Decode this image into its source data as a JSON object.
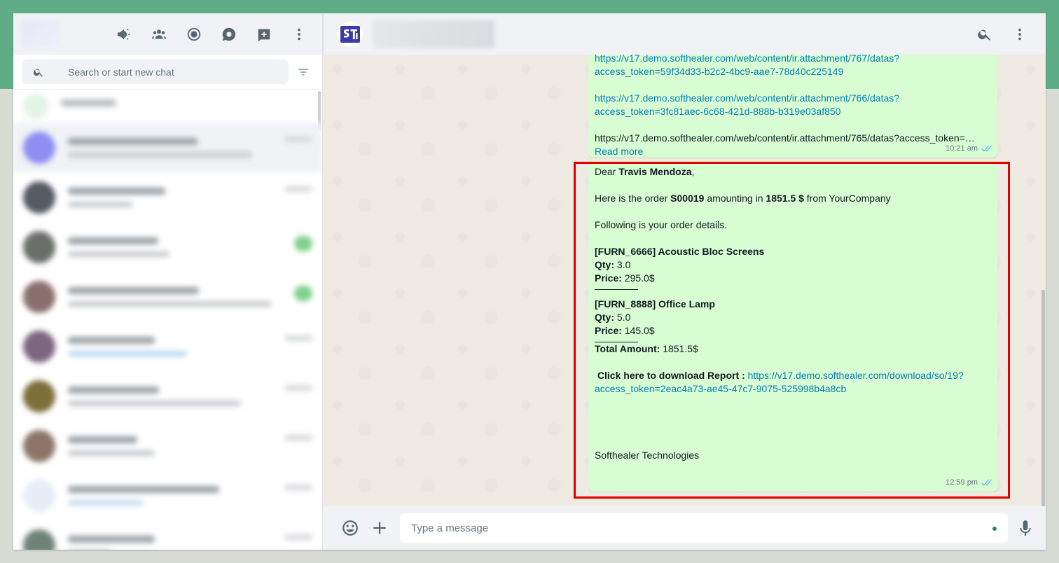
{
  "colors": {
    "top_band": "#5fad86",
    "bubble": "#d9fdd3",
    "link": "#027eb5",
    "highlight": "#e00000",
    "tick": "#53bdeb"
  },
  "sidebar": {
    "icons": [
      "communities-icon",
      "groups-icon",
      "status-icon",
      "channels-icon",
      "new-chat-icon",
      "menu-icon"
    ],
    "search_placeholder": "Search or start new chat"
  },
  "header": {
    "logo_icon": "softhealer-logo-icon",
    "icons": [
      "search-icon",
      "menu-icon"
    ]
  },
  "messages": [
    {
      "links": [
        {
          "url_line1": "https://v17.demo.softhealer.com/web/content/ir.attachment/767/datas?",
          "url_line2": "access_token=59f34d33-b2c2-4bc9-aae7-78d40c225149"
        },
        {
          "url_line1": "https://v17.demo.softhealer.com/web/content/ir.attachment/766/datas?",
          "url_line2": "access_token=3fc81aec-6c68-421d-888b-b319e03af850"
        }
      ],
      "truncated_text": "https://v17.demo.softhealer.com/web/content/ir.attachment/765/datas?access_token=…",
      "read_more": "Read more",
      "time": "10:21 am"
    },
    {
      "dear": "Dear ",
      "customer": "Travis Mendoza",
      "comma": ",",
      "order_prefix": "Here is the order ",
      "order_no": "S00019",
      "amount_prefix": " amounting in ",
      "amount": "1851.5 $",
      "company_suffix": " from YourCompany",
      "details_intro": "Following is your order details.",
      "items": [
        {
          "name": "[FURN_6666] Acoustic Bloc Screens",
          "qty_label": "Qty:",
          "qty": " 3.0",
          "price_label": "Price:",
          "price": " 295.0$"
        },
        {
          "name": "[FURN_8888] Office Lamp",
          "qty_label": "Qty:",
          "qty": " 5.0",
          "price_label": "Price:",
          "price": " 145.0$"
        }
      ],
      "total_label": "Total Amount:",
      "total": " 1851.5$",
      "download_label": "Click here to download Report :",
      "download_url_line1": "https://v17.demo.softhealer.com/download/so/19?",
      "download_url_line2": "access_token=2eac4a73-ae45-47c7-9075-525998b4a8cb",
      "signature": "Softhealer Technologies",
      "time": "12:59 pm"
    }
  ],
  "footer": {
    "placeholder": "Type a message",
    "icons": [
      "emoji-icon",
      "attach-plus-icon",
      "microphone-icon"
    ]
  }
}
